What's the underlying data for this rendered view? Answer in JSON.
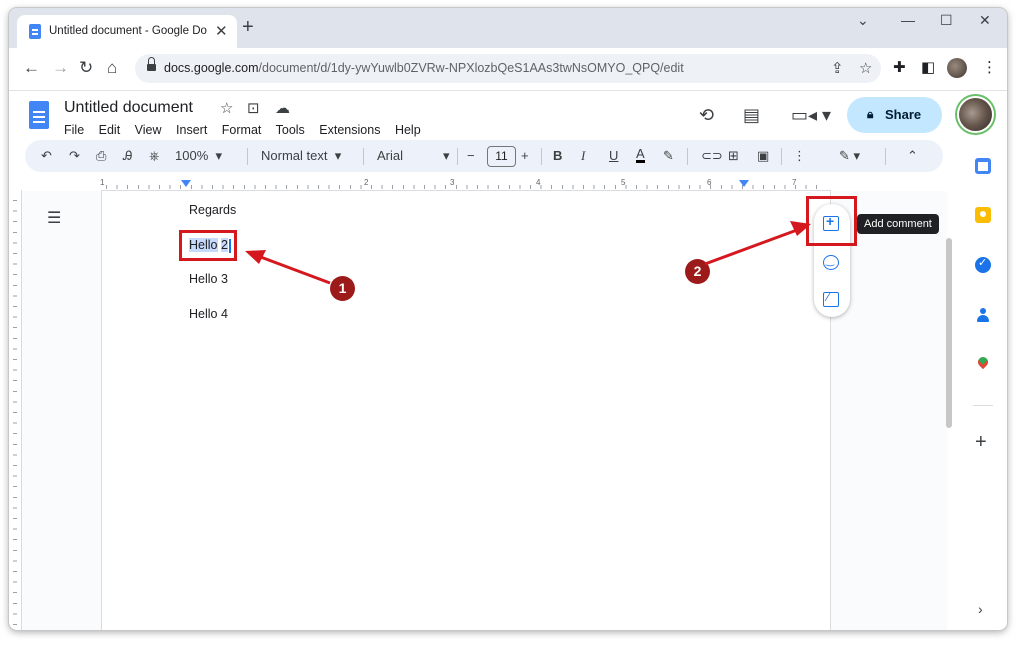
{
  "browser": {
    "tab_title": "Untitled document - Google Doc",
    "new_tab_label": "+",
    "url_host": "docs.google.com",
    "url_path": "/document/d/1dy-ywYuwlb0ZVRw-NPXlozbQeS1AAs3twNsOMYO_QPQ/edit"
  },
  "docs": {
    "title": "Untitled document",
    "menu": [
      "File",
      "Edit",
      "View",
      "Insert",
      "Format",
      "Tools",
      "Extensions",
      "Help"
    ],
    "share_label": "Share"
  },
  "toolbar": {
    "zoom": "100%",
    "style": "Normal text",
    "font": "Arial",
    "font_size": "11",
    "bold": "B",
    "italic": "I",
    "underline": "U",
    "text_color": "A"
  },
  "ruler": {
    "marks": [
      "1",
      "2",
      "3",
      "4",
      "5",
      "6",
      "7"
    ]
  },
  "document": {
    "lines": [
      "Regards",
      "Hello 2",
      "Hello 3",
      "Hello 4"
    ],
    "selected_prefix": "Hello",
    "selected_suffix": "2"
  },
  "float_bar": {
    "tooltip": "Add comment"
  },
  "annotations": {
    "badge_1": "1",
    "badge_2": "2"
  },
  "colors": {
    "accent": "#1a73e8",
    "share_bg": "#c2e7ff",
    "annotation_red": "#d4181e",
    "badge_red": "#9c1a1a",
    "toolbar_bg": "#edf2fa"
  },
  "icons": {
    "tab": [
      "docs-favicon",
      "close-icon",
      "plus-icon"
    ],
    "window": [
      "chevron-down-icon",
      "minimize-icon",
      "maximize-icon",
      "close-icon"
    ],
    "nav": [
      "back-icon",
      "forward-icon",
      "reload-icon",
      "home-icon",
      "lock-icon",
      "share-page-icon",
      "star-icon",
      "extensions-icon",
      "side-panel-icon",
      "more-vert-icon"
    ],
    "toolbar": [
      "undo-icon",
      "redo-icon",
      "print-icon",
      "spellcheck-icon",
      "paint-format-icon",
      "highlighter-icon",
      "link-icon",
      "insert-comment-icon",
      "image-icon",
      "edit-mode-icon",
      "collapse-icon"
    ],
    "side_panel": [
      "calendar-icon",
      "keep-icon",
      "tasks-icon",
      "contacts-icon",
      "maps-icon",
      "plus-icon"
    ]
  }
}
